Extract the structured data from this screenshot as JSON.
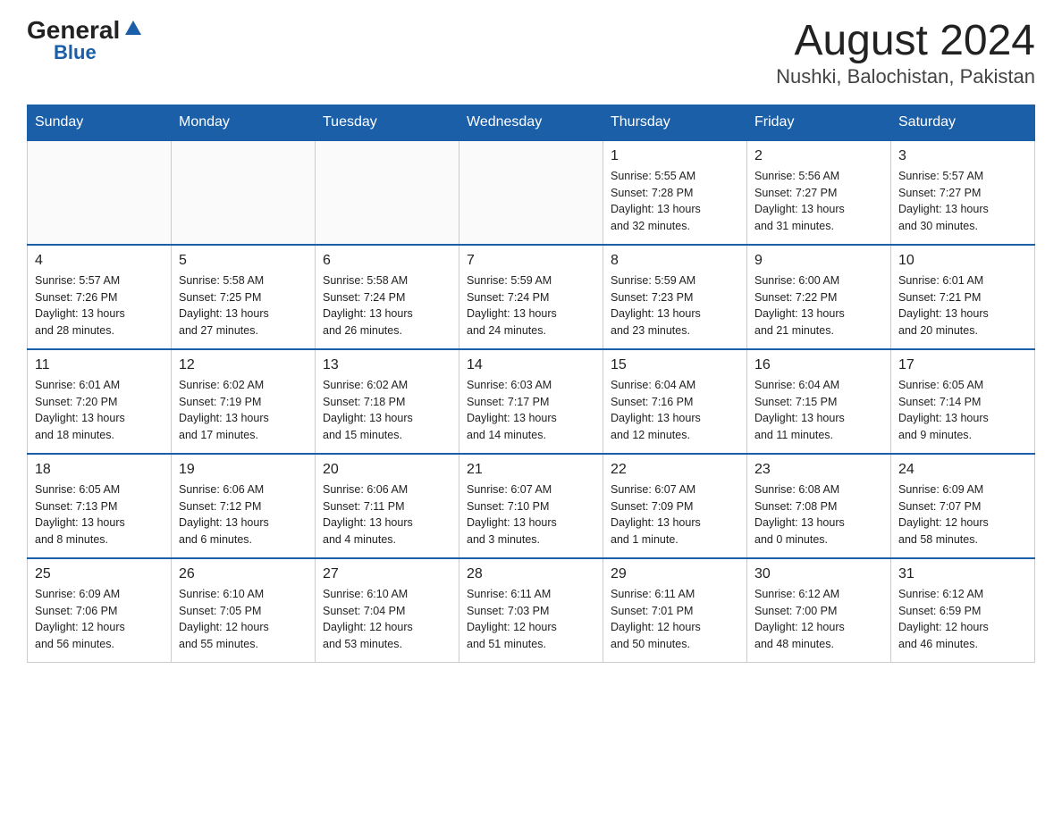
{
  "header": {
    "logo_general": "General",
    "logo_blue": "Blue",
    "title": "August 2024",
    "subtitle": "Nushki, Balochistan, Pakistan"
  },
  "weekdays": [
    "Sunday",
    "Monday",
    "Tuesday",
    "Wednesday",
    "Thursday",
    "Friday",
    "Saturday"
  ],
  "weeks": [
    [
      {
        "day": "",
        "info": ""
      },
      {
        "day": "",
        "info": ""
      },
      {
        "day": "",
        "info": ""
      },
      {
        "day": "",
        "info": ""
      },
      {
        "day": "1",
        "info": "Sunrise: 5:55 AM\nSunset: 7:28 PM\nDaylight: 13 hours\nand 32 minutes."
      },
      {
        "day": "2",
        "info": "Sunrise: 5:56 AM\nSunset: 7:27 PM\nDaylight: 13 hours\nand 31 minutes."
      },
      {
        "day": "3",
        "info": "Sunrise: 5:57 AM\nSunset: 7:27 PM\nDaylight: 13 hours\nand 30 minutes."
      }
    ],
    [
      {
        "day": "4",
        "info": "Sunrise: 5:57 AM\nSunset: 7:26 PM\nDaylight: 13 hours\nand 28 minutes."
      },
      {
        "day": "5",
        "info": "Sunrise: 5:58 AM\nSunset: 7:25 PM\nDaylight: 13 hours\nand 27 minutes."
      },
      {
        "day": "6",
        "info": "Sunrise: 5:58 AM\nSunset: 7:24 PM\nDaylight: 13 hours\nand 26 minutes."
      },
      {
        "day": "7",
        "info": "Sunrise: 5:59 AM\nSunset: 7:24 PM\nDaylight: 13 hours\nand 24 minutes."
      },
      {
        "day": "8",
        "info": "Sunrise: 5:59 AM\nSunset: 7:23 PM\nDaylight: 13 hours\nand 23 minutes."
      },
      {
        "day": "9",
        "info": "Sunrise: 6:00 AM\nSunset: 7:22 PM\nDaylight: 13 hours\nand 21 minutes."
      },
      {
        "day": "10",
        "info": "Sunrise: 6:01 AM\nSunset: 7:21 PM\nDaylight: 13 hours\nand 20 minutes."
      }
    ],
    [
      {
        "day": "11",
        "info": "Sunrise: 6:01 AM\nSunset: 7:20 PM\nDaylight: 13 hours\nand 18 minutes."
      },
      {
        "day": "12",
        "info": "Sunrise: 6:02 AM\nSunset: 7:19 PM\nDaylight: 13 hours\nand 17 minutes."
      },
      {
        "day": "13",
        "info": "Sunrise: 6:02 AM\nSunset: 7:18 PM\nDaylight: 13 hours\nand 15 minutes."
      },
      {
        "day": "14",
        "info": "Sunrise: 6:03 AM\nSunset: 7:17 PM\nDaylight: 13 hours\nand 14 minutes."
      },
      {
        "day": "15",
        "info": "Sunrise: 6:04 AM\nSunset: 7:16 PM\nDaylight: 13 hours\nand 12 minutes."
      },
      {
        "day": "16",
        "info": "Sunrise: 6:04 AM\nSunset: 7:15 PM\nDaylight: 13 hours\nand 11 minutes."
      },
      {
        "day": "17",
        "info": "Sunrise: 6:05 AM\nSunset: 7:14 PM\nDaylight: 13 hours\nand 9 minutes."
      }
    ],
    [
      {
        "day": "18",
        "info": "Sunrise: 6:05 AM\nSunset: 7:13 PM\nDaylight: 13 hours\nand 8 minutes."
      },
      {
        "day": "19",
        "info": "Sunrise: 6:06 AM\nSunset: 7:12 PM\nDaylight: 13 hours\nand 6 minutes."
      },
      {
        "day": "20",
        "info": "Sunrise: 6:06 AM\nSunset: 7:11 PM\nDaylight: 13 hours\nand 4 minutes."
      },
      {
        "day": "21",
        "info": "Sunrise: 6:07 AM\nSunset: 7:10 PM\nDaylight: 13 hours\nand 3 minutes."
      },
      {
        "day": "22",
        "info": "Sunrise: 6:07 AM\nSunset: 7:09 PM\nDaylight: 13 hours\nand 1 minute."
      },
      {
        "day": "23",
        "info": "Sunrise: 6:08 AM\nSunset: 7:08 PM\nDaylight: 13 hours\nand 0 minutes."
      },
      {
        "day": "24",
        "info": "Sunrise: 6:09 AM\nSunset: 7:07 PM\nDaylight: 12 hours\nand 58 minutes."
      }
    ],
    [
      {
        "day": "25",
        "info": "Sunrise: 6:09 AM\nSunset: 7:06 PM\nDaylight: 12 hours\nand 56 minutes."
      },
      {
        "day": "26",
        "info": "Sunrise: 6:10 AM\nSunset: 7:05 PM\nDaylight: 12 hours\nand 55 minutes."
      },
      {
        "day": "27",
        "info": "Sunrise: 6:10 AM\nSunset: 7:04 PM\nDaylight: 12 hours\nand 53 minutes."
      },
      {
        "day": "28",
        "info": "Sunrise: 6:11 AM\nSunset: 7:03 PM\nDaylight: 12 hours\nand 51 minutes."
      },
      {
        "day": "29",
        "info": "Sunrise: 6:11 AM\nSunset: 7:01 PM\nDaylight: 12 hours\nand 50 minutes."
      },
      {
        "day": "30",
        "info": "Sunrise: 6:12 AM\nSunset: 7:00 PM\nDaylight: 12 hours\nand 48 minutes."
      },
      {
        "day": "31",
        "info": "Sunrise: 6:12 AM\nSunset: 6:59 PM\nDaylight: 12 hours\nand 46 minutes."
      }
    ]
  ]
}
